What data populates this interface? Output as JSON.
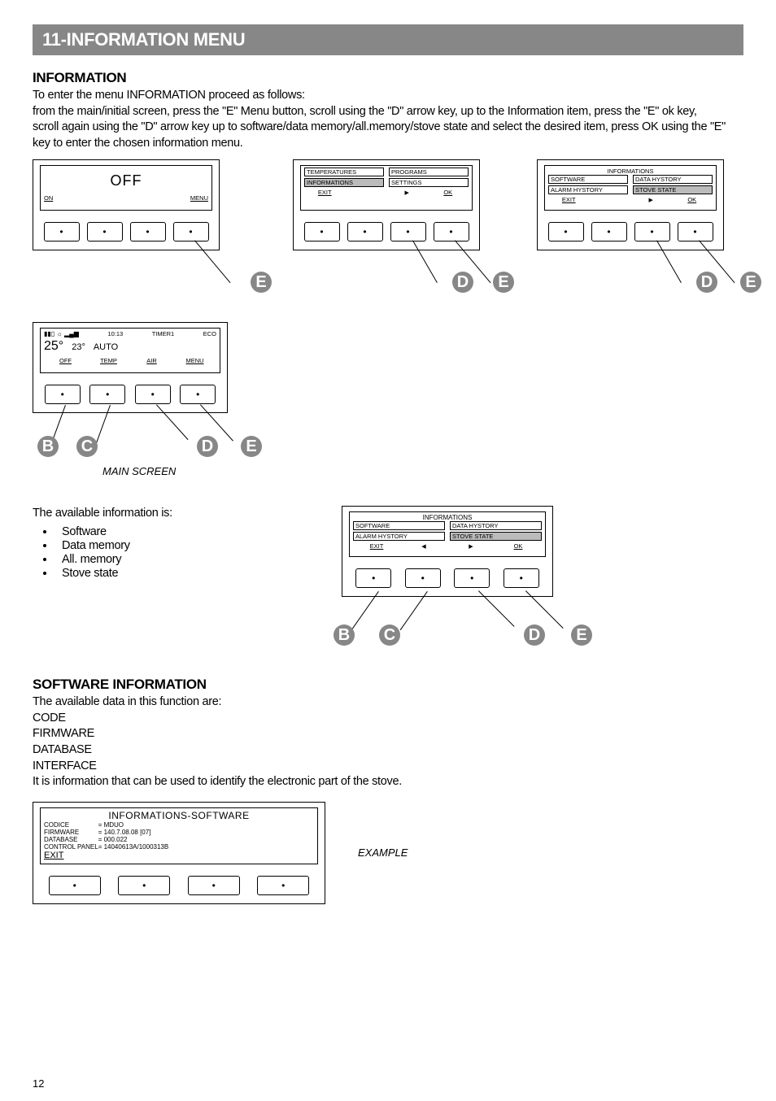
{
  "page": {
    "title": "11-INFORMATION MENU",
    "number": "12"
  },
  "intro": {
    "heading": "INFORMATION",
    "line1": "To enter the menu INFORMATION proceed as follows:",
    "line2": " from the main/initial screen, press the \"E\" Menu button, scroll using the \"D\" arrow key, up to the Information item, press the \"E\" ok key,",
    "line3": " scroll again using the \"D\" arrow key up to software/data memory/all.memory/stove state and select the desired item, press OK using the \"E\" key to enter the chosen information menu."
  },
  "screen_off": {
    "main": "OFF",
    "labels": {
      "a": "ON",
      "d": "MENU"
    }
  },
  "screen_menu": {
    "items": {
      "a": "TEMPERATURES",
      "b": "PROGRAMS",
      "c": "INFORMATIONS",
      "d": "SETTINGS"
    },
    "labels": {
      "a": "EXIT",
      "c_icon": "▶",
      "d": "OK"
    }
  },
  "screen_info": {
    "header": "INFORMATIONS",
    "items": {
      "a": "SOFTWARE",
      "b": "DATA HYSTORY",
      "c": "ALARM HYSTORY",
      "d": "STOVE STATE"
    },
    "labels": {
      "a": "EXIT",
      "c_icon": "▶",
      "d": "OK"
    }
  },
  "screen_main": {
    "time": "10:13",
    "timer": "TIMER1",
    "eco": "ECO",
    "temp_room": "25°",
    "temp_set": "23°",
    "mode": "AUTO",
    "labels": {
      "a": "OFF",
      "b": "TEMP",
      "c": "AIR",
      "d": "MENU"
    },
    "caption": "MAIN SCREEN"
  },
  "screen_info2": {
    "header": "INFORMATIONS",
    "items": {
      "a": "SOFTWARE",
      "b": "DATA HYSTORY",
      "c": "ALARM HYSTORY",
      "d": "STOVE STATE"
    },
    "labels": {
      "a": "EXIT",
      "b_icon": "◀",
      "c_icon": "▶",
      "d": "OK"
    }
  },
  "available": {
    "lead": "The available information is:",
    "items": [
      "Software",
      "Data memory",
      "All. memory",
      "Stove state"
    ]
  },
  "software_info": {
    "heading": "SOFTWARE INFORMATION",
    "lead": "The available data in this function are:",
    "rows": [
      "CODE",
      "FIRMWARE",
      "DATABASE",
      "INTERFACE"
    ],
    "tail": "It is information that can be used to identify the electronic part of the stove."
  },
  "screen_sw": {
    "title": "INFORMATIONS-SOFTWARE",
    "rows": [
      {
        "k": "CODICE",
        "v": "= MDUO"
      },
      {
        "k": "FIRMWARE",
        "v": "= 140.7.08.08 [07]"
      },
      {
        "k": "DATABASE",
        "v": "= 000.022"
      },
      {
        "k": "CONTROL PANEL",
        "v": "= 14040613A/1000313B"
      }
    ],
    "exit": "EXIT",
    "caption": "EXAMPLE"
  },
  "keys": {
    "B": "B",
    "C": "C",
    "D": "D",
    "E": "E"
  }
}
